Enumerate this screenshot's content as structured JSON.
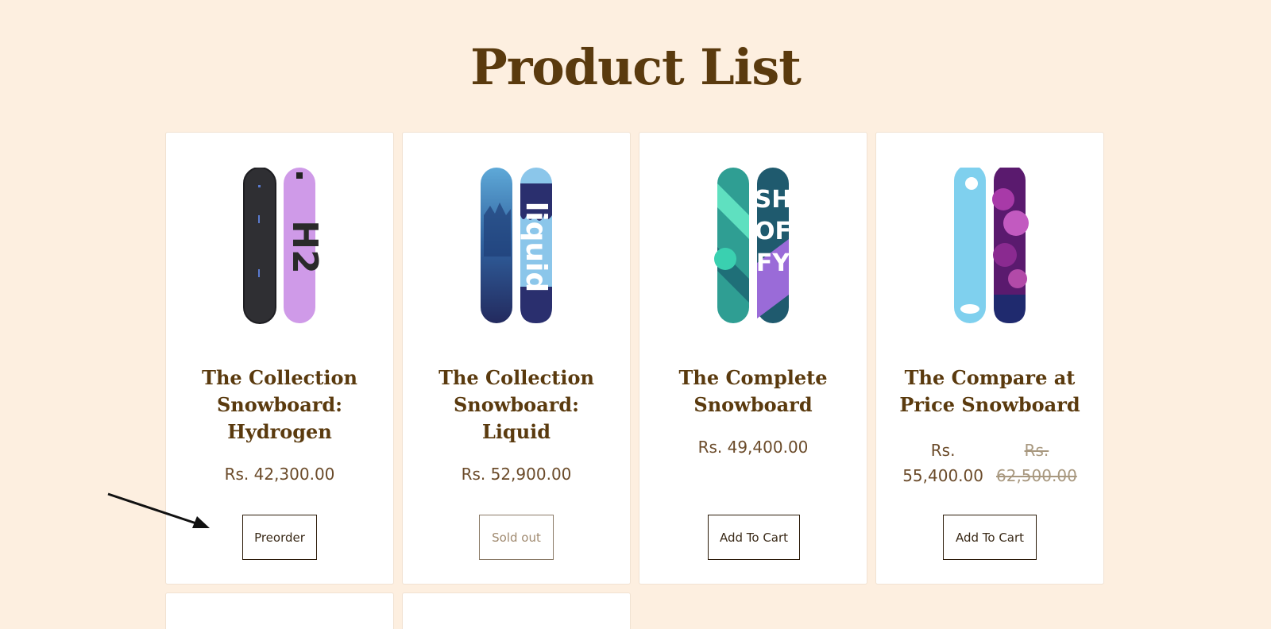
{
  "page": {
    "title": "Product List"
  },
  "products": [
    {
      "title": "The Collection Snowboard: Hydrogen",
      "price": "Rs. 42,300.00",
      "button": "Preorder",
      "button_state": "enabled"
    },
    {
      "title": "The Collection Snowboard: Liquid",
      "price": "Rs. 52,900.00",
      "button": "Sold out",
      "button_state": "disabled"
    },
    {
      "title": "The Complete Snowboard",
      "price": "Rs. 49,400.00",
      "button": "Add To Cart",
      "button_state": "enabled"
    },
    {
      "title": "The Compare at Price Snowboard",
      "price_sale_line1": "Rs.",
      "price_sale_line2": "55,400.00",
      "price_compare_line1": "Rs.",
      "price_compare_line2": "62,500.00",
      "button": "Add To Cart",
      "button_state": "enabled"
    }
  ],
  "colors": {
    "background": "#fdefe0",
    "title": "#5a3a0e",
    "price": "#6b4b2a",
    "annotation_arrow": "#111111"
  }
}
